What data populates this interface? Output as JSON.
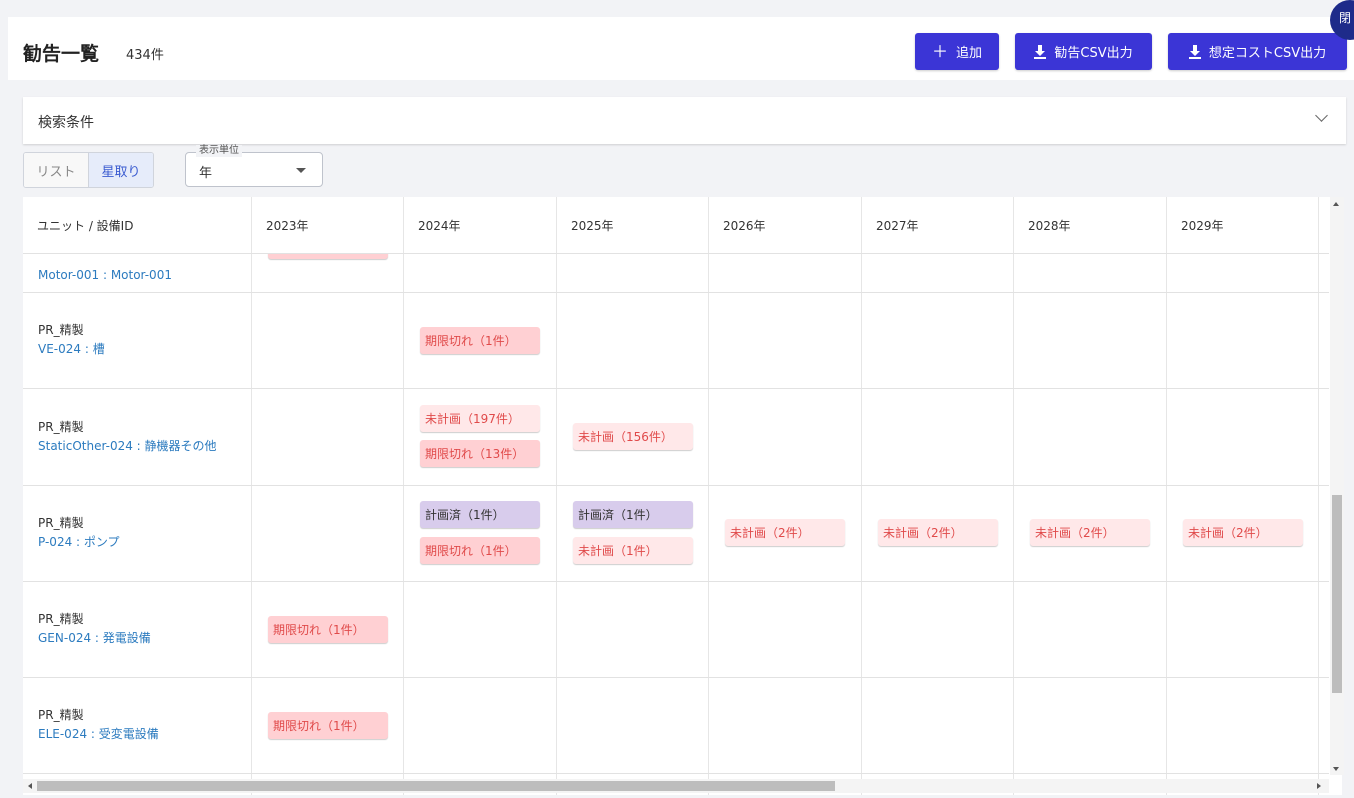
{
  "header": {
    "title": "勧告一覧",
    "count": "434件",
    "add_button": "追加",
    "recommend_csv_button": "勧告CSV出力",
    "cost_csv_button": "想定コストCSV出力",
    "close_badge": "閉"
  },
  "search": {
    "label": "検索条件"
  },
  "view_toggle": {
    "list": "リスト",
    "star": "星取り"
  },
  "unit_select": {
    "legend": "表示単位",
    "value": "年"
  },
  "table": {
    "columns": [
      "ユニット / 設備ID",
      "2023年",
      "2024年",
      "2025年",
      "2026年",
      "2027年",
      "2028年",
      "2029年"
    ],
    "partial_row": {
      "equipment": "Motor-001 : Motor-001"
    },
    "rows": [
      {
        "unit": "PR_精製",
        "equipment": "VE-024 : 槽"
      },
      {
        "unit": "PR_精製",
        "equipment": "StaticOther-024 : 静機器その他"
      },
      {
        "unit": "PR_精製",
        "equipment": "P-024 : ポンプ"
      },
      {
        "unit": "PR_精製",
        "equipment": "GEN-024 : 発電設備"
      },
      {
        "unit": "PR_精製",
        "equipment": "ELE-024 : 受変電設備"
      }
    ],
    "chips": {
      "ve_2024_expired": "期限切れ（1件）",
      "so_2024_unplanned": "未計画（197件）",
      "so_2024_expired": "期限切れ（13件）",
      "so_2025_unplanned": "未計画（156件）",
      "p_2024_planned": "計画済（1件）",
      "p_2024_expired": "期限切れ（1件）",
      "p_2025_planned": "計画済（1件）",
      "p_2025_unplanned": "未計画（1件）",
      "p_2026_unplanned": "未計画（2件）",
      "p_2027_unplanned": "未計画（2件）",
      "p_2028_unplanned": "未計画（2件）",
      "p_2029_unplanned": "未計画（2件）",
      "gen_2023_expired": "期限切れ（1件）",
      "ele_2023_expired": "期限切れ（1件）"
    },
    "colors": {
      "expired_bg": "#ffd0d3",
      "unplanned_bg": "#ffe8e9",
      "planned_bg": "#d8ccec",
      "accent": "#3b35d6",
      "link": "#2c7bbf"
    }
  }
}
